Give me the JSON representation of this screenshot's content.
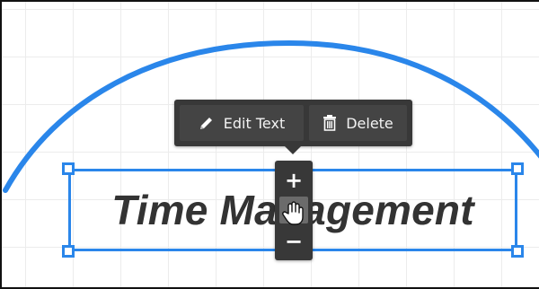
{
  "canvas": {
    "accent_color": "#2a86ea",
    "grid": true
  },
  "toolbar": {
    "edit_label": "Edit Text",
    "edit_icon": "pencil-icon",
    "delete_label": "Delete",
    "delete_icon": "trash-icon"
  },
  "textbox": {
    "text": "Time Management",
    "color": "#333333"
  },
  "zoom_control": {
    "plus_label": "+",
    "minus_label": "−"
  },
  "cursor": "hand-grab-cursor"
}
